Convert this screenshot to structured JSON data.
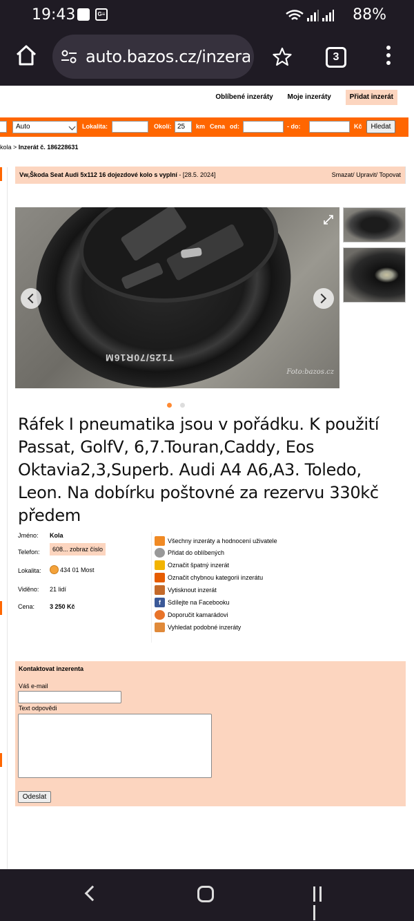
{
  "status": {
    "time": "19:43",
    "battery": "88%"
  },
  "browser": {
    "url": "auto.bazos.cz/inzera",
    "tab_count": "3"
  },
  "top_links": {
    "favorites": "Oblíbené inzeráty",
    "mine": "Moje inzeráty",
    "add": "Přidat inzerát"
  },
  "search": {
    "category": "Auto",
    "locality_label": "Lokalita:",
    "radius_label": "Okolí:",
    "radius_value": "25",
    "km_label": "km",
    "price_label": "Cena",
    "from_label": "od:",
    "to_label": "- do:",
    "currency": "Kč",
    "button": "Hledat"
  },
  "breadcrumb": {
    "prefix": "kola > ",
    "current": "Inzerát č. 186228631"
  },
  "ad": {
    "title": "Vw,Škoda Seat Audi 5x112 16 dojezdové kolo s vyplní",
    "date": " - [28.5. 2024]",
    "actions": "Smazat/ Upravit/ Topovat",
    "watermark": "Foto:bazos.cz",
    "tire_text": "T125/70R16M",
    "description": "Ráfek I pneumatika jsou v pořádku. K použití Passat, GolfV, 6,7.Touran,Caddy, Eos Oktavia2,3,Superb. Audi A4 A6,A3. Toledo, Leon. Na dobírku poštovné za rezervu 330kč předem"
  },
  "info": {
    "name_label": "Jméno:",
    "name": "Kola",
    "phone_label": "Telefon:",
    "phone": "608... zobraz číslo",
    "locality_label": "Lokalita:",
    "locality": "434 01 Most",
    "views_label": "Viděno:",
    "views": "21 lidí",
    "price_label": "Cena:",
    "price": "3 250 Kč"
  },
  "actions": [
    "Všechny inzeráty a hodnocení uživatele",
    "Přidat do oblíbených",
    "Označit špatný inzerát",
    "Označit chybnou kategorii inzerátu",
    "Vytisknout inzerát",
    "Sdílejte na Facebooku",
    "Doporučit kamarádovi",
    "Vyhledat podobné inzeráty"
  ],
  "contact": {
    "heading": "Kontaktovat inzerenta",
    "email_label": "Váš e-mail",
    "reply_label": "Text odpovědi",
    "send": "Odeslat"
  },
  "colors": {
    "accent": "#ff6600",
    "panel": "#fcd5bf"
  }
}
